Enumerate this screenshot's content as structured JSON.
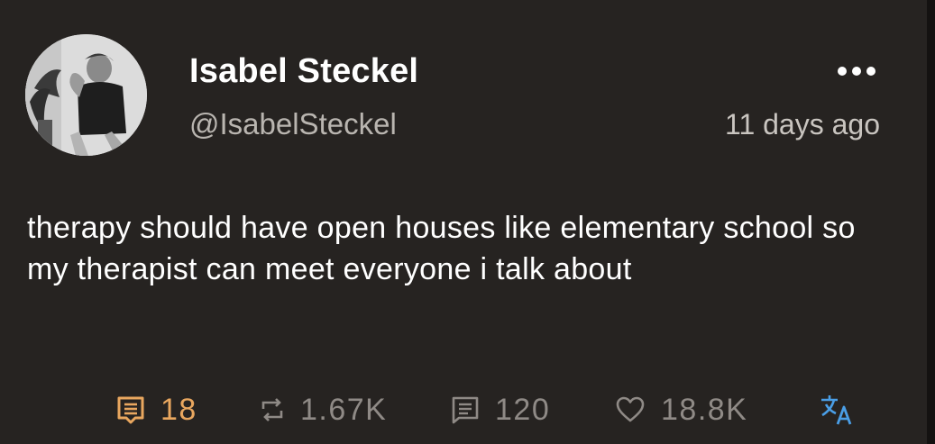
{
  "post": {
    "author_name": "Isabel Steckel",
    "author_handle": "@IsabelSteckel",
    "timestamp": "11 days ago",
    "text": "therapy should have open houses like elementary school so my therapist can meet everyone i talk about"
  },
  "stats": {
    "comments": "18",
    "reposts": "1.67K",
    "quotes": "120",
    "likes": "18.8K"
  },
  "icons": {
    "avatar": "avatar-photo",
    "more": "more-options-icon",
    "comments": "comment-icon",
    "reposts": "repost-icon",
    "quotes": "quote-icon",
    "likes": "heart-icon",
    "translate": "translate-icon"
  },
  "colors": {
    "background": "#262321",
    "highlight": "#e9a75f",
    "muted": "#8f8a86",
    "translate": "#4a9ee6"
  }
}
